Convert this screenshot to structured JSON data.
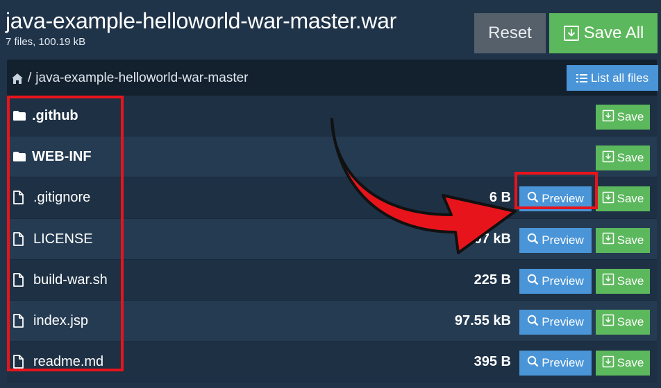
{
  "archive": {
    "title": "java-example-helloworld-war-master.war",
    "summary": "7 files, 100.19 kB"
  },
  "buttons": {
    "reset_label": "Reset",
    "save_all_label": "Save All",
    "list_all_label": "List all files",
    "preview_label": "Preview",
    "save_label": "Save"
  },
  "breadcrumb": {
    "separator": "/",
    "path": "java-example-helloworld-war-master"
  },
  "entries": [
    {
      "name": ".github",
      "type": "folder",
      "size": ""
    },
    {
      "name": "WEB-INF",
      "type": "folder",
      "size": ""
    },
    {
      "name": ".gitignore",
      "type": "file",
      "size": "6 B"
    },
    {
      "name": "LICENSE",
      "type": "file",
      "size": "1.07 kB"
    },
    {
      "name": "build-war.sh",
      "type": "file",
      "size": "225 B"
    },
    {
      "name": "index.jsp",
      "type": "file",
      "size": "97.55 kB"
    },
    {
      "name": "readme.md",
      "type": "file",
      "size": "395 B"
    }
  ],
  "colors": {
    "background": "#1f3349",
    "green": "#5cb85c",
    "blue": "#4a95d8",
    "grey": "#55606b",
    "annotation_red": "#e8141b"
  }
}
